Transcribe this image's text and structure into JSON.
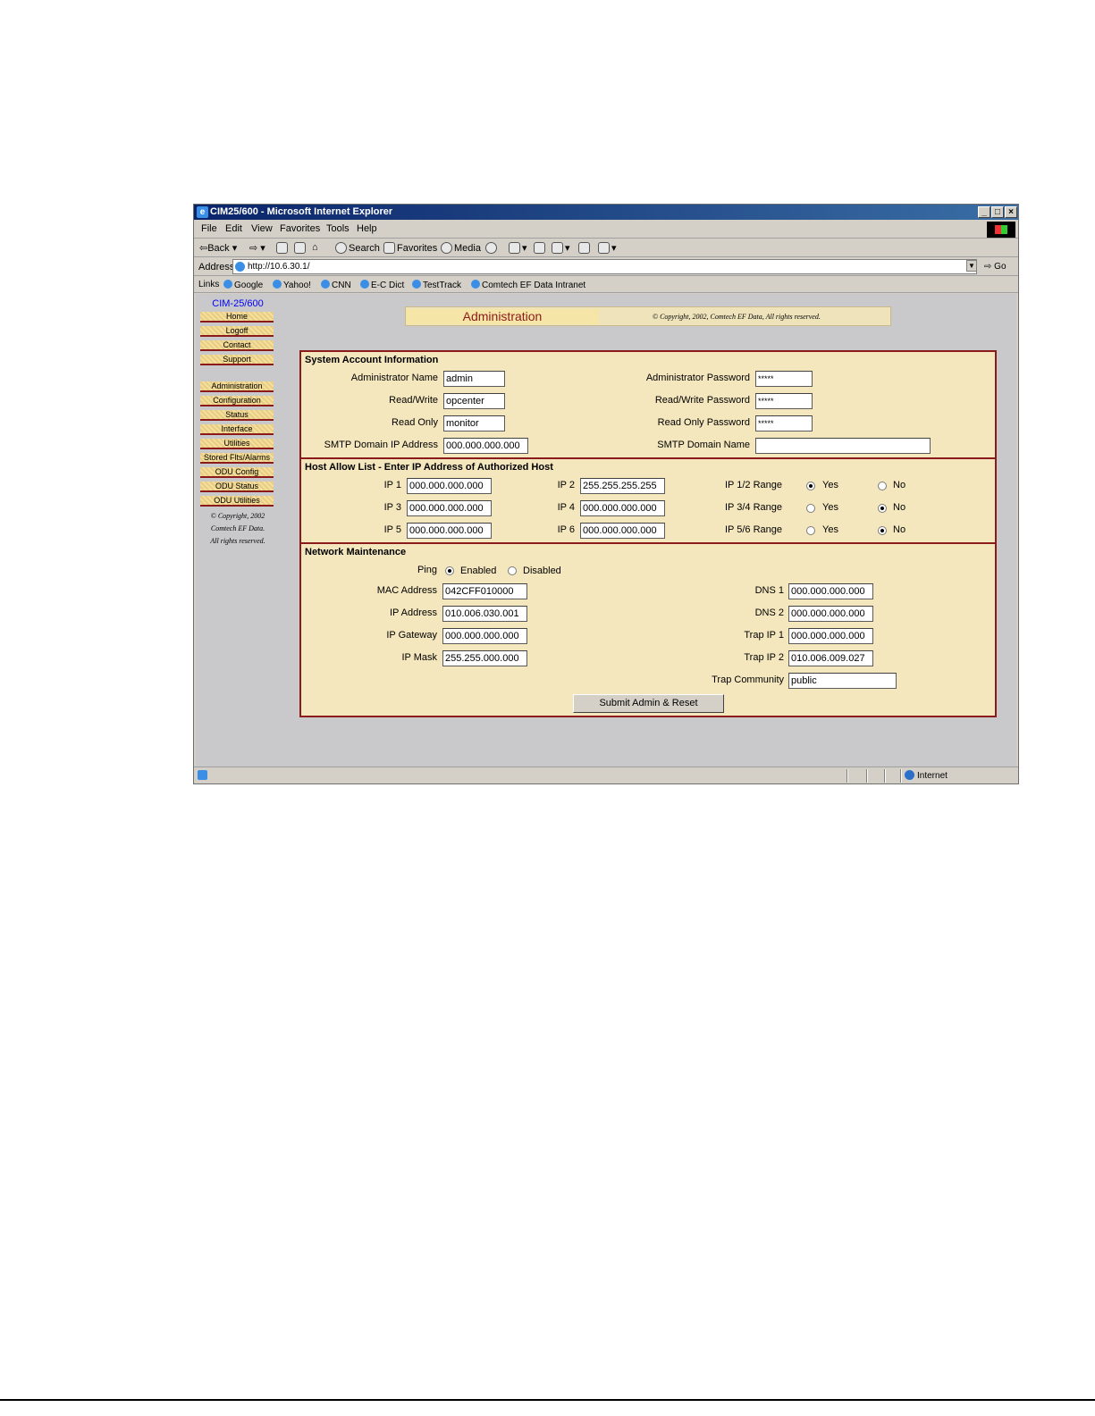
{
  "window": {
    "title": "CIM25/600 - Microsoft Internet Explorer",
    "controls": {
      "minimize": "_",
      "maximize": "□",
      "close": "×"
    }
  },
  "menu": [
    "File",
    "Edit",
    "View",
    "Favorites",
    "Tools",
    "Help"
  ],
  "toolbar": {
    "back": "Back",
    "search": "Search",
    "favorites": "Favorites",
    "media": "Media"
  },
  "address": {
    "label": "Address",
    "url": "http://10.6.30.1/",
    "go": "Go"
  },
  "links": {
    "label": "Links",
    "items": [
      "Google",
      "Yahoo!",
      "CNN",
      "E-C Dict",
      "TestTrack",
      "Comtech EF Data Intranet"
    ]
  },
  "status": {
    "zone": "Internet"
  },
  "nav": {
    "title": "CIM-25/600",
    "group1": [
      "Home",
      "Logoff",
      "Contact",
      "Support"
    ],
    "group2": [
      "Administration",
      "Configuration",
      "Status",
      "Interface",
      "Utilities",
      "Stored Flts/Alarms",
      "ODU Config",
      "ODU Status",
      "ODU Utilities"
    ],
    "copyright": [
      "© Copyright, 2002",
      "Comtech EF Data.",
      "All rights reserved."
    ]
  },
  "header": {
    "title": "Administration",
    "copyright": "© Copyright, 2002, Comtech EF Data, All rights reserved."
  },
  "account": {
    "title": "System Account Information",
    "admin_name_label": "Administrator Name",
    "admin_name": "admin",
    "rw_label": "Read/Write",
    "rw": "opcenter",
    "ro_label": "Read Only",
    "ro": "monitor",
    "smtp_ip_label": "SMTP Domain IP Address",
    "smtp_ip": "000.000.000.000",
    "admin_pw_label": "Administrator Password",
    "admin_pw": "*****",
    "rw_pw_label": "Read/Write Password",
    "rw_pw": "*****",
    "ro_pw_label": "Read Only Password",
    "ro_pw": "*****",
    "smtp_name_label": "SMTP Domain Name",
    "smtp_name": ""
  },
  "hosts": {
    "title": "Host Allow List - Enter IP Address of Authorized Host",
    "ip1_label": "IP 1",
    "ip1": "000.000.000.000",
    "ip2_label": "IP 2",
    "ip2": "255.255.255.255",
    "ip3_label": "IP 3",
    "ip3": "000.000.000.000",
    "ip4_label": "IP 4",
    "ip4": "000.000.000.000",
    "ip5_label": "IP 5",
    "ip5": "000.000.000.000",
    "ip6_label": "IP 6",
    "ip6": "000.000.000.000",
    "range12_label": "IP 1/2 Range",
    "range12": "Yes",
    "range34_label": "IP 3/4 Range",
    "range34": "No",
    "range56_label": "IP 5/6 Range",
    "range56": "No",
    "yes": "Yes",
    "no": "No"
  },
  "network": {
    "title": "Network Maintenance",
    "ping_label": "Ping",
    "ping": "Enabled",
    "enabled": "Enabled",
    "disabled": "Disabled",
    "mac_label": "MAC Address",
    "mac": "042CFF010000",
    "ip_label": "IP Address",
    "ip": "010.006.030.001",
    "gw_label": "IP Gateway",
    "gw": "000.000.000.000",
    "mask_label": "IP Mask",
    "mask": "255.255.000.000",
    "dns1_label": "DNS 1",
    "dns1": "000.000.000.000",
    "dns2_label": "DNS 2",
    "dns2": "000.000.000.000",
    "trap1_label": "Trap IP 1",
    "trap1": "000.000.000.000",
    "trap2_label": "Trap IP 2",
    "trap2": "010.006.009.027",
    "community_label": "Trap Community",
    "community": "public",
    "submit": "Submit Admin & Reset"
  }
}
